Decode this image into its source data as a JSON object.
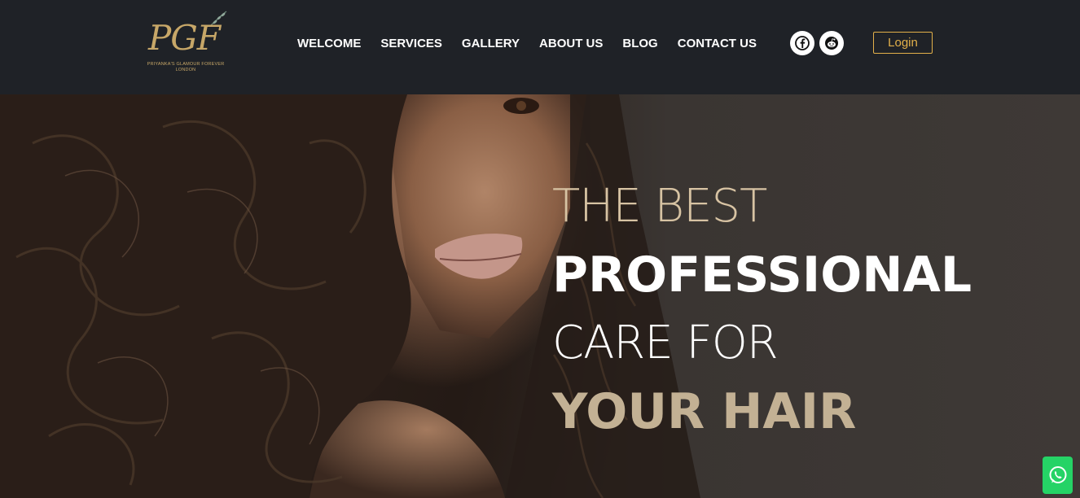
{
  "brand": {
    "monogram": "PGF",
    "tagline_line1": "PRIYANKA'S GLAMOUR FOREVER",
    "tagline_line2": "LONDON"
  },
  "nav": {
    "items": [
      {
        "label": "WELCOME"
      },
      {
        "label": "SERVICES"
      },
      {
        "label": "GALLERY"
      },
      {
        "label": "ABOUT US"
      },
      {
        "label": "BLOG"
      },
      {
        "label": "CONTACT US"
      }
    ]
  },
  "social": {
    "icons": [
      "facebook-icon",
      "reddit-icon"
    ]
  },
  "header": {
    "login_label": "Login"
  },
  "hero": {
    "line1": "THE BEST",
    "line2": "PROFESSIONAL",
    "line3": "CARE FOR",
    "line4": "YOUR HAIR"
  },
  "colors": {
    "header_bg": "#1f2227",
    "accent_gold": "#e2b04a",
    "hero_tan": "#c3b194",
    "whatsapp_green": "#25d366"
  }
}
